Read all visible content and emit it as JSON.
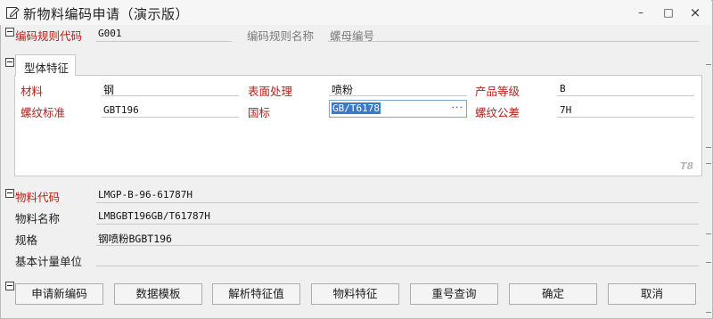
{
  "window": {
    "title": "新物料编码申请（演示版）",
    "controls": {
      "minimize": "–",
      "maximize": "□",
      "close": "×"
    }
  },
  "rule": {
    "code_label": "编码规则代码",
    "code_value": "G001",
    "name_label": "编码规则名称",
    "name_value": "螺母编号"
  },
  "features": {
    "tab_label": "型体特征",
    "fields": {
      "material_label": "材料",
      "material_value": "钢",
      "surface_label": "表面处理",
      "surface_value": "喷粉",
      "grade_label": "产品等级",
      "grade_value": "B",
      "thread_std_label": "螺纹标准",
      "thread_std_value": "GBT196",
      "national_label": "国标",
      "national_value": "GB/T6178",
      "tolerance_label": "螺纹公差",
      "tolerance_value": "7H"
    },
    "watermark": "T8"
  },
  "material": {
    "code_label": "物料代码",
    "code_value": "LMGP-B-96-61787H",
    "name_label": "物料名称",
    "name_value": "LMBGBT196GB/T61787H",
    "spec_label": "规格",
    "spec_value": "钢喷粉BGBT196",
    "unit_label": "基本计量单位",
    "unit_value": ""
  },
  "buttons": {
    "apply": "申请新编码",
    "template": "数据模板",
    "parse": "解析特征值",
    "features": "物料特征",
    "dup_query": "重号查询",
    "confirm": "确定",
    "cancel": "取消"
  },
  "colors": {
    "required_label": "#b0231b",
    "selection": "#3a78c9",
    "focus_border": "#7aa6d4"
  }
}
